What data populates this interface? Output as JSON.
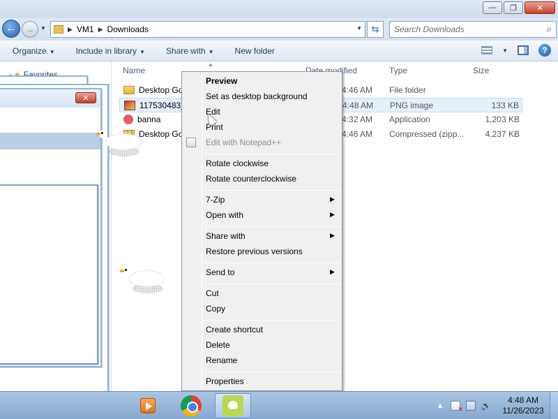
{
  "window": {
    "controls": {
      "minimize": "—",
      "maximize": "❐",
      "close": "✕"
    }
  },
  "navigation": {
    "back_glyph": "←",
    "forward_glyph": "→",
    "breadcrumb": [
      "VM1",
      "Downloads"
    ],
    "search_placeholder": "Search Downloads"
  },
  "commandbar": {
    "organize": "Organize",
    "include_in_library": "Include in library",
    "share_with": "Share with",
    "new_folder": "New folder",
    "help": "?"
  },
  "navpane": {
    "favorites": "Favorites"
  },
  "columns": {
    "name": "Name",
    "date_modified": "Date modified",
    "type": "Type",
    "size": "Size"
  },
  "files": [
    {
      "name": "Desktop Go",
      "date": "3 4:46 AM",
      "type": "File folder",
      "size": "",
      "icon": "folder-icon"
    },
    {
      "name": "117530483_9",
      "date": "3 4:48 AM",
      "type": "PNG image",
      "size": "133 KB",
      "icon": "png-image-icon",
      "selected": true
    },
    {
      "name": "banna",
      "date": "3 4:32 AM",
      "type": "Application",
      "size": "1,203 KB",
      "icon": "application-icon"
    },
    {
      "name": "Desktop Go",
      "date": "3 4:46 AM",
      "type": "Compressed (zipp...",
      "size": "4,237 KB",
      "icon": "zip-icon"
    }
  ],
  "context_menu": {
    "items": [
      {
        "label": "Preview",
        "bold": true,
        "submenu": false,
        "disabled": false
      },
      {
        "label": "Set as desktop background",
        "submenu": false
      },
      {
        "label": "Edit",
        "submenu": false
      },
      {
        "label": "Print",
        "submenu": false
      },
      {
        "label": "Edit with Notepad++",
        "disabled": true,
        "submenu": false
      },
      {
        "label": "Rotate clockwise",
        "submenu": false
      },
      {
        "label": "Rotate counterclockwise",
        "submenu": false
      },
      {
        "label": "7-Zip",
        "submenu": true
      },
      {
        "label": "Open with",
        "submenu": true
      },
      {
        "label": "Share with",
        "submenu": true
      },
      {
        "label": "Restore previous versions",
        "submenu": false
      },
      {
        "label": "Send to",
        "submenu": true
      },
      {
        "label": "Cut",
        "submenu": false
      },
      {
        "label": "Copy",
        "submenu": false
      },
      {
        "label": "Create shortcut",
        "submenu": false
      },
      {
        "label": "Delete",
        "submenu": false
      },
      {
        "label": "Rename",
        "submenu": false
      },
      {
        "label": "Properties",
        "submenu": false
      }
    ],
    "submenu_glyph": "▶"
  },
  "taskbar": {
    "clock_time": "4:48 AM",
    "clock_date": "11/26/2023",
    "tray_up_glyph": "▲",
    "volume_glyph": "🔈"
  },
  "colors": {
    "selection": "#e5f0fb",
    "menu_bg": "#f0f0f0",
    "taskbar": "#86a9d0"
  }
}
